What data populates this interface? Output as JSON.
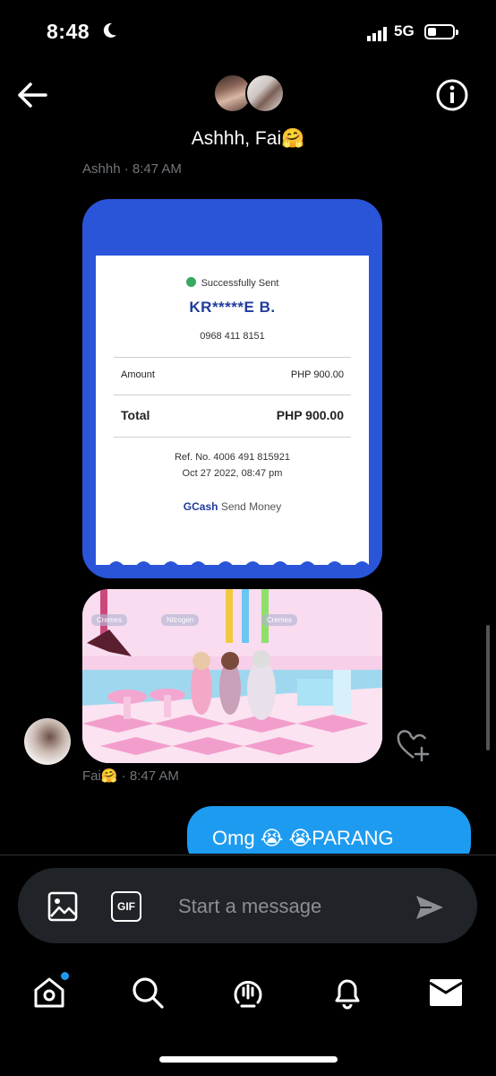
{
  "status_bar": {
    "time": "8:48",
    "network": "5G"
  },
  "header": {
    "title": "Ashhh, Fai🤗"
  },
  "messages": {
    "sender_top_timestamp": "Ashhh · 8:47 AM",
    "receipt": {
      "status": "Successfully Sent",
      "recipient": "KR*****E B.",
      "phone": "0968 411 8151",
      "amount_label": "Amount",
      "amount_value": "PHP 900.00",
      "total_label": "Total",
      "total_value": "PHP 900.00",
      "ref": "Ref. No. 4006 491 815921",
      "date": "Oct 27 2022, 08:47 pm",
      "brand": "GCash",
      "brand_suffix": "Send Money"
    },
    "game_image_labels": [
      "Cremes",
      "Nitrogen",
      "Cremes"
    ],
    "sender_bottom_timestamp": "Fai🤗 · 8:47 AM",
    "sent_message": "Omg 😭 😭PARANG"
  },
  "composer": {
    "placeholder": "Start a message",
    "gif_label": "GIF"
  },
  "colors": {
    "accent": "#1d9bf0",
    "gcash_blue": "#2a55d9",
    "composer_bg": "#202327"
  },
  "tabs": [
    "home-icon",
    "search-icon",
    "spaces-icon",
    "bell-icon",
    "mail-icon"
  ]
}
